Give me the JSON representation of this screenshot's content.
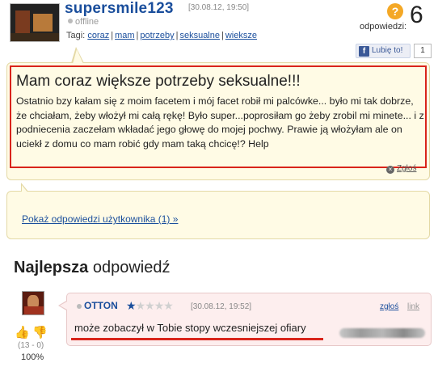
{
  "question": {
    "author": "supersmile123",
    "datetime": "[30.08.12, 19:50]",
    "status": "offline",
    "tags_label": "Tagi:",
    "tags": [
      "coraz",
      "mam",
      "potrzeby",
      "seksualne",
      "wieksze"
    ],
    "answers_label": "odpowiedzi:",
    "answers_count": "6",
    "help_icon": "?",
    "like_button": "Lubię to!",
    "like_count": "1",
    "title": "Mam coraz większe potrzeby seksualne!!!",
    "body": "Ostatnio bzy kałam się z moim facetem i mój facet robił mi palcówke... było mi tak dobrze, że chciałam, żeby włożył mi całą rękę! Było super...poprosiłam go żeby zrobil mi minete... i z podniecenia zaczełam wkładać jego głowę do mojej pochwy. Prawie ją włożyłam ale on uciekł z domu co mam robić gdy mam taką chcicę!? Help",
    "report_label": "Zgłoś"
  },
  "show_answers_link": "Pokaż odpowiedzi użytkownika (1) »",
  "best_answer": {
    "heading_bold": "Najlepsza",
    "heading_rest": "odpowiedź",
    "author": "OTTON",
    "rating_stars": 1,
    "rating_max": 5,
    "datetime": "[30.08.12, 19:52]",
    "report_label": "zgłoś",
    "link_label": "link",
    "text": "może zobaczył w Tobie stopy wczesniejszej ofiary",
    "votes": "(13 - 0)",
    "percent": "100%"
  },
  "colors": {
    "link": "#1a4e9c",
    "highlight_red": "#d9241b",
    "question_bg": "#fffbe5",
    "answer_bg": "#fdeeee"
  }
}
